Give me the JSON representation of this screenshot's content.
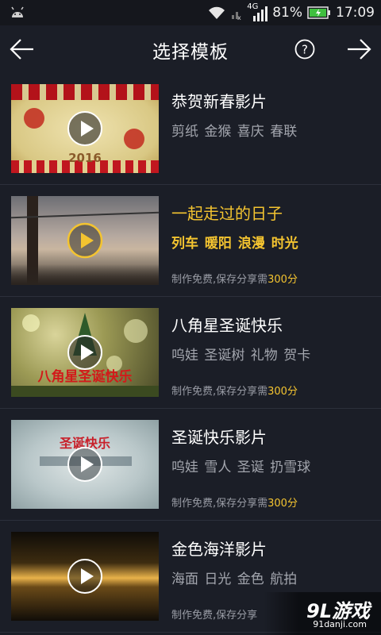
{
  "status_bar": {
    "network": "4G",
    "battery": "81%",
    "time": "17:09",
    "icons": [
      "android-icon",
      "wifi-icon",
      "signal-icon",
      "battery-icon"
    ]
  },
  "header": {
    "title": "选择模板",
    "back_icon": "arrow-left-icon",
    "help_icon": "help-circle-icon",
    "next_icon": "arrow-right-icon"
  },
  "templates": [
    {
      "title": "恭贺新春影片",
      "tags": "剪纸 金猴 喜庆 春联",
      "price_prefix": "",
      "price_amount": "",
      "thumb_text": "2016",
      "selected": false
    },
    {
      "title": "一起走过的日子",
      "tags": "列车 暖阳 浪漫 时光",
      "price_prefix": "制作免费,保存分享需",
      "price_amount": "300分",
      "thumb_text": "",
      "selected": true
    },
    {
      "title": "八角星圣诞快乐",
      "tags": "呜娃 圣诞树 礼物 贺卡",
      "price_prefix": "制作免费,保存分享需",
      "price_amount": "300分",
      "thumb_text": "八角星圣诞快乐",
      "selected": false
    },
    {
      "title": "圣诞快乐影片",
      "tags": "呜娃 雪人 圣诞 扔雪球",
      "price_prefix": "制作免费,保存分享需",
      "price_amount": "300分",
      "thumb_text": "圣诞快乐",
      "selected": false
    },
    {
      "title": "金色海洋影片",
      "tags": "海面 日光 金色 航拍",
      "price_prefix": "制作免费,保存分享",
      "price_amount": "",
      "thumb_text": "",
      "selected": false
    }
  ],
  "watermark": {
    "main": "9L游戏",
    "sub": "91danji.com"
  },
  "colors": {
    "background": "#1b1e27",
    "accent": "#f4c430",
    "tag_text": "#a3a6ae"
  }
}
